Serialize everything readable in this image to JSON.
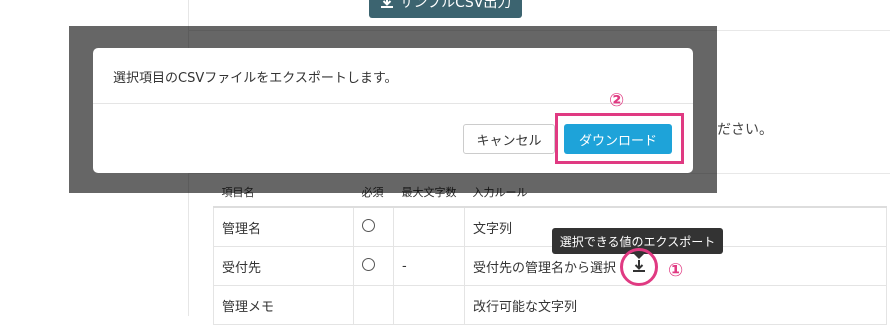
{
  "toolbar": {
    "sample_csv_label": "サンプルCSV出力"
  },
  "background_text": {
    "tail": "ださい。"
  },
  "table": {
    "headers": [
      "項目名",
      "必須",
      "最大文字数",
      "入力ルール"
    ],
    "rows": [
      {
        "name": "管理名",
        "required": true,
        "max": "",
        "rule": "文字列"
      },
      {
        "name": "受付先",
        "required": true,
        "max": "-",
        "rule": "受付先の管理名から選択"
      },
      {
        "name": "管理メモ",
        "required": false,
        "max": "",
        "rule": "改行可能な文字列"
      }
    ]
  },
  "tooltip": {
    "text": "選択できる値のエクスポート"
  },
  "modal": {
    "message": "選択項目のCSVファイルをエクスポートします。",
    "cancel_label": "キャンセル",
    "download_label": "ダウンロード"
  },
  "annotations": {
    "step1": "①",
    "step2": "②"
  },
  "colors": {
    "primary": "#1ea3d9",
    "callout": "#e03a82",
    "toolbar_button": "#3c6470",
    "tooltip_bg": "#333333"
  }
}
